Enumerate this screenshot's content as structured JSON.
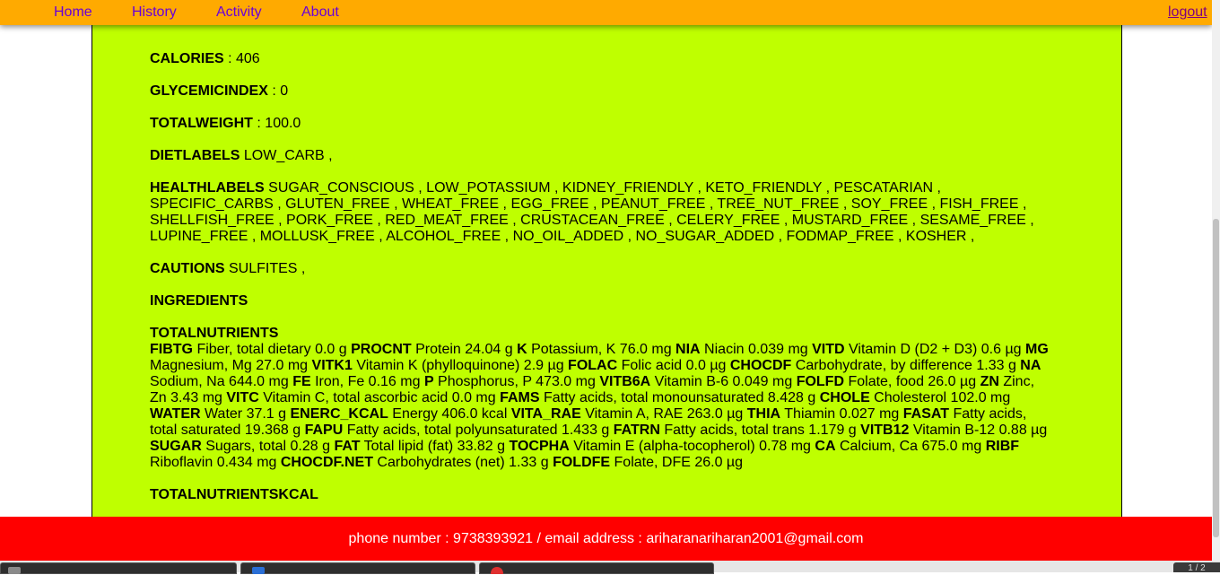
{
  "nav": {
    "home": "Home",
    "history": "History",
    "activity": "Activity",
    "about": "About",
    "logout": "logout"
  },
  "fields": {
    "calories_label": "CALORIES",
    "calories_value": " : 406",
    "glycemic_label": "GLYCEMICINDEX",
    "glycemic_value": " : 0",
    "weight_label": "TOTALWEIGHT",
    "weight_value": " : 100.0",
    "diet_label": "DIETLABELS",
    "diet_value": " LOW_CARB ,",
    "health_label": "HEALTHLABELS",
    "health_value": " SUGAR_CONSCIOUS , LOW_POTASSIUM , KIDNEY_FRIENDLY , KETO_FRIENDLY , PESCATARIAN , SPECIFIC_CARBS , GLUTEN_FREE , WHEAT_FREE , EGG_FREE , PEANUT_FREE , TREE_NUT_FREE , SOY_FREE , FISH_FREE , SHELLFISH_FREE , PORK_FREE , RED_MEAT_FREE , CRUSTACEAN_FREE , CELERY_FREE , MUSTARD_FREE , SESAME_FREE , LUPINE_FREE , MOLLUSK_FREE , ALCOHOL_FREE , NO_OIL_ADDED , NO_SUGAR_ADDED , FODMAP_FREE , KOSHER ,",
    "cautions_label": "CAUTIONS",
    "cautions_value": " SULFITES ,",
    "ingredients_label": "INGREDIENTS",
    "totalnutrients_label": "TOTALNUTRIENTS",
    "totalnutrientskcal_label": "TOTALNUTRIENTSKCAL"
  },
  "nutrients": [
    {
      "code": "FIBTG",
      "desc": " Fiber, total dietary 0.0 g "
    },
    {
      "code": "PROCNT",
      "desc": " Protein 24.04 g "
    },
    {
      "code": "K",
      "desc": " Potassium, K 76.0 mg "
    },
    {
      "code": "NIA",
      "desc": " Niacin 0.039 mg "
    },
    {
      "code": "VITD",
      "desc": " Vitamin D (D2 + D3) 0.6 µg "
    },
    {
      "code": "MG",
      "desc": " Magnesium, Mg 27.0 mg "
    },
    {
      "code": "VITK1",
      "desc": " Vitamin K (phylloquinone) 2.9 µg "
    },
    {
      "code": "FOLAC",
      "desc": " Folic acid 0.0 µg "
    },
    {
      "code": "CHOCDF",
      "desc": " Carbohydrate, by difference 1.33 g "
    },
    {
      "code": "NA",
      "desc": " Sodium, Na 644.0 mg "
    },
    {
      "code": "FE",
      "desc": " Iron, Fe 0.16 mg "
    },
    {
      "code": "P",
      "desc": " Phosphorus, P 473.0 mg "
    },
    {
      "code": "VITB6A",
      "desc": " Vitamin B-6 0.049 mg "
    },
    {
      "code": "FOLFD",
      "desc": " Folate, food 26.0 µg "
    },
    {
      "code": "ZN",
      "desc": " Zinc, Zn 3.43 mg "
    },
    {
      "code": "VITC",
      "desc": " Vitamin C, total ascorbic acid 0.0 mg "
    },
    {
      "code": "FAMS",
      "desc": " Fatty acids, total monounsaturated 8.428 g "
    },
    {
      "code": "CHOLE",
      "desc": " Cholesterol 102.0 mg "
    },
    {
      "code": "WATER",
      "desc": " Water 37.1 g "
    },
    {
      "code": "ENERC_KCAL",
      "desc": " Energy 406.0 kcal "
    },
    {
      "code": "VITA_RAE",
      "desc": " Vitamin A, RAE 263.0 µg "
    },
    {
      "code": "THIA",
      "desc": " Thiamin 0.027 mg "
    },
    {
      "code": "FASAT",
      "desc": " Fatty acids, total saturated 19.368 g "
    },
    {
      "code": "FAPU",
      "desc": " Fatty acids, total polyunsaturated 1.433 g "
    },
    {
      "code": "FATRN",
      "desc": " Fatty acids, total trans 1.179 g "
    },
    {
      "code": "VITB12",
      "desc": " Vitamin B-12 0.88 µg "
    },
    {
      "code": "SUGAR",
      "desc": " Sugars, total 0.28 g "
    },
    {
      "code": "FAT",
      "desc": " Total lipid (fat) 33.82 g "
    },
    {
      "code": "TOCPHA",
      "desc": " Vitamin E (alpha-tocopherol) 0.78 mg "
    },
    {
      "code": "CA",
      "desc": " Calcium, Ca 675.0 mg "
    },
    {
      "code": "RIBF",
      "desc": " Riboflavin 0.434 mg "
    },
    {
      "code": "CHOCDF.NET",
      "desc": " Carbohydrates (net) 1.33 g "
    },
    {
      "code": "FOLDFE",
      "desc": " Folate, DFE 26.0 µg"
    }
  ],
  "footer": {
    "text": "phone number : 9738393921 / email address : ariharanariharan2001@gmail.com"
  },
  "taskbar": {
    "pager": "1 / 2"
  },
  "colors": {
    "navbar": "#ffaa00",
    "nav_link": "#6a00d8",
    "panel": "#bfff00",
    "footer": "#ff0000"
  }
}
